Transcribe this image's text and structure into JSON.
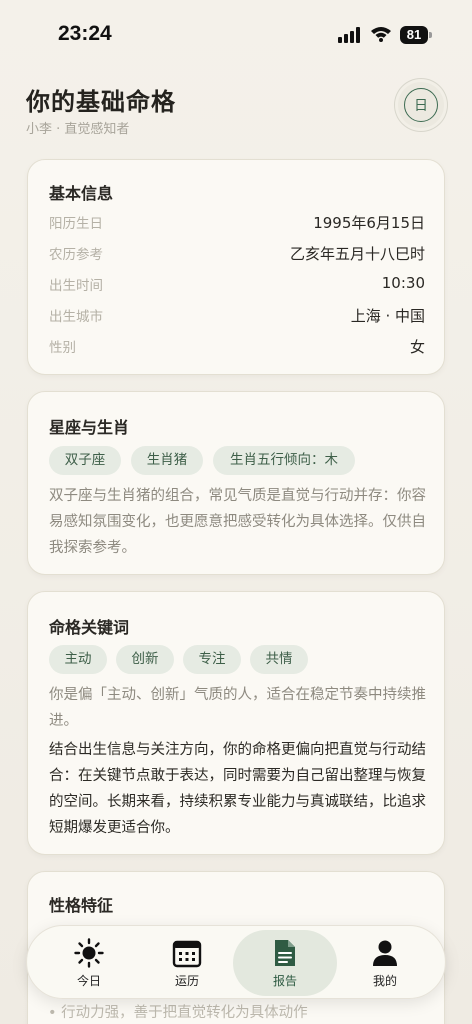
{
  "status_bar": {
    "time": "23:24",
    "battery": "81"
  },
  "header": {
    "title": "你的基础命格",
    "subtitle": "小李 · 直觉感知者",
    "day_button_label": "日"
  },
  "basic_info": {
    "title": "基本信息",
    "rows": [
      {
        "label": "阳历生日",
        "value": "1995年6月15日"
      },
      {
        "label": "农历参考",
        "value": "乙亥年五月十八巳时"
      },
      {
        "label": "出生时间",
        "value": "10:30"
      },
      {
        "label": "出生城市",
        "value": "上海 · 中国"
      },
      {
        "label": "性别",
        "value": "女"
      }
    ]
  },
  "zodiac": {
    "title": "星座与生肖",
    "tags": [
      "双子座",
      "生肖猪",
      "生肖五行倾向：木"
    ],
    "description": "双子座与生肖猪的组合，常见气质是直觉与行动并存：你容易感知氛围变化，也更愿意把感受转化为具体选择。仅供自我探索参考。"
  },
  "keywords": {
    "title": "命格关键词",
    "tags": [
      "主动",
      "创新",
      "专注",
      "共情"
    ],
    "summary": "你是偏「主动、创新」气质的人，适合在稳定节奏中持续推进。",
    "detail": "结合出生信息与关注方向，你的命格更偏向把直觉与行动结合：在关键节点敢于表达，同时需要为自己留出整理与恢复的空间。长期来看，持续积累专业能力与真诚联结，比追求短期爆发更适合你。"
  },
  "traits": {
    "title": "性格特征",
    "items": [
      "行动力强，善于把直觉转化为具体动作"
    ]
  },
  "tabbar": {
    "tabs": [
      {
        "label": "今日",
        "icon": "sun-icon"
      },
      {
        "label": "运历",
        "icon": "calendar-icon"
      },
      {
        "label": "报告",
        "icon": "document-icon"
      },
      {
        "label": "我的",
        "icon": "person-icon"
      }
    ],
    "active": "报告"
  },
  "colors": {
    "accent": "#3d6b52",
    "tag_bg": "#e6ebe3",
    "background": "#f4f1ea"
  }
}
